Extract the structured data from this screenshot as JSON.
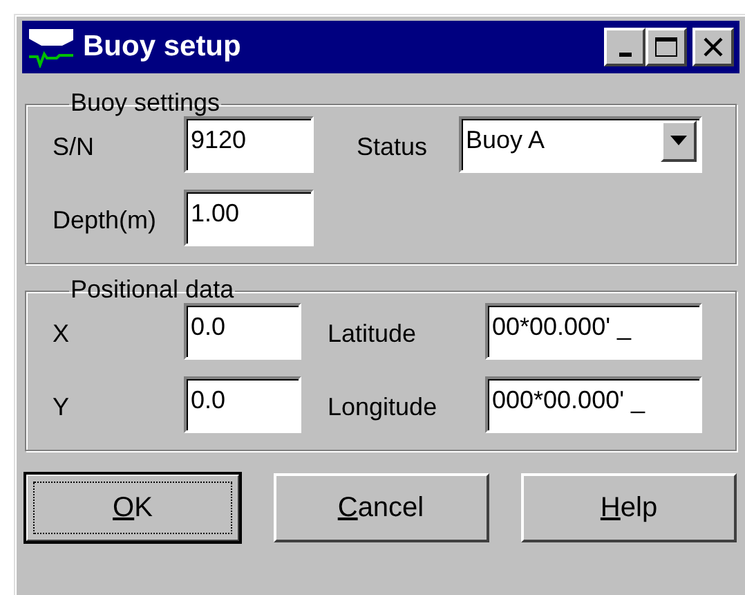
{
  "window": {
    "title": "Buoy setup"
  },
  "title_buttons": [
    {
      "kind": "minimize"
    },
    {
      "kind": "maximize"
    },
    {
      "kind": "close"
    }
  ],
  "buoy_settings": {
    "title": "Buoy settings",
    "serial": {
      "label": "S/N",
      "value": "9120"
    },
    "status": {
      "label": "Status",
      "value": "Buoy A"
    },
    "depth": {
      "label": "Depth(m)",
      "value": "1.00"
    }
  },
  "positional_data": {
    "title": "Positional data",
    "rows": [
      {
        "axis": {
          "label": "X",
          "value": "0.0"
        },
        "coordinate": {
          "label": "Latitude",
          "value": "00*00.000' _"
        }
      },
      {
        "axis": {
          "label": "Y",
          "value": "0.0"
        },
        "coordinate": {
          "label": "Longitude",
          "value": "000*00.000' _"
        }
      }
    ]
  },
  "buttons": [
    {
      "accel": "O",
      "rest": "K",
      "default": true
    },
    {
      "accel": "C",
      "rest": "ancel",
      "default": false
    },
    {
      "accel": "H",
      "rest": "elp",
      "default": false
    }
  ]
}
